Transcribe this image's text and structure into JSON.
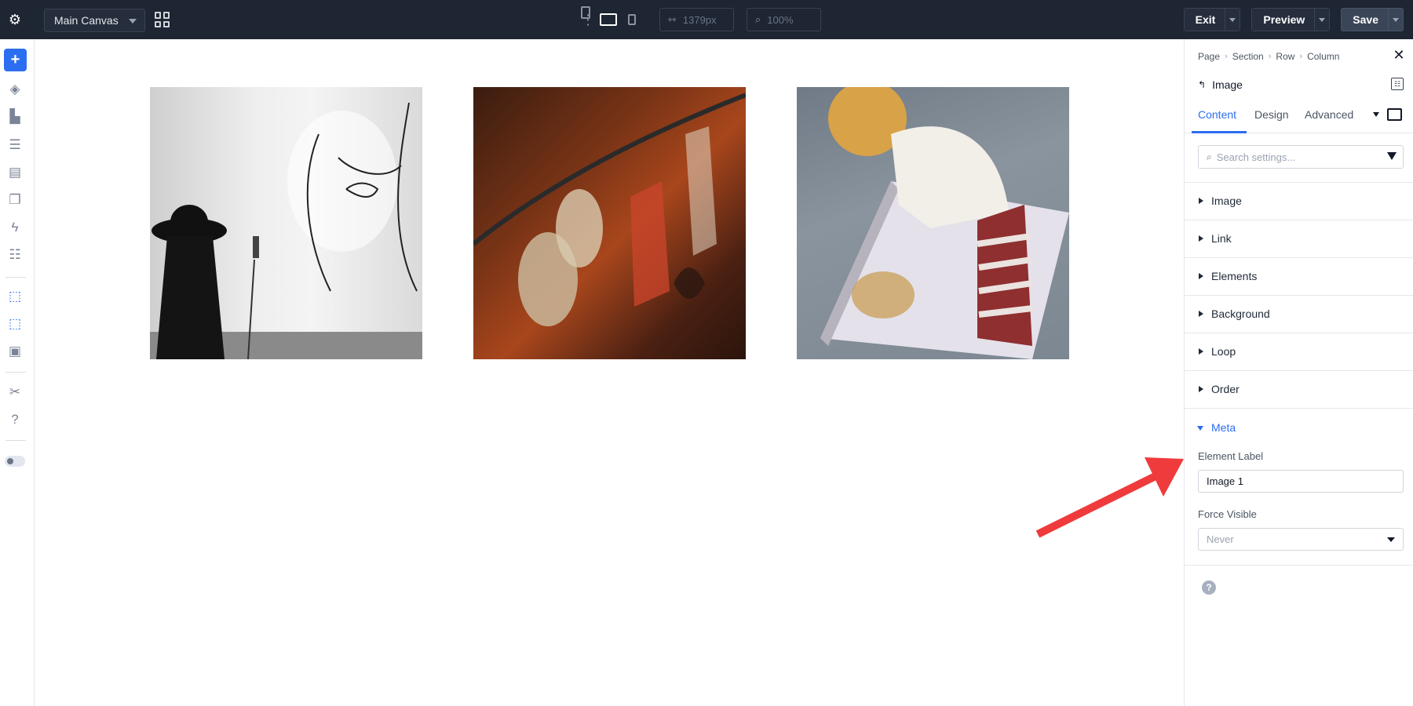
{
  "topbar": {
    "canvas_select": "Main Canvas",
    "width_value": "1379px",
    "zoom_value": "100%",
    "exit_label": "Exit",
    "preview_label": "Preview",
    "save_label": "Save"
  },
  "panel": {
    "breadcrumbs": [
      "Page",
      "Section",
      "Row",
      "Column"
    ],
    "element_title": "Image",
    "tabs": [
      "Content",
      "Design",
      "Advanced"
    ],
    "active_tab": "Content",
    "search_placeholder": "Search settings...",
    "groups": [
      "Image",
      "Link",
      "Elements",
      "Background",
      "Loop",
      "Order"
    ],
    "meta": {
      "title": "Meta",
      "element_label_label": "Element Label",
      "element_label_value": "Image 1",
      "force_visible_label": "Force Visible",
      "force_visible_value": "Never"
    },
    "help_icon": "?"
  },
  "canvas": {
    "images": [
      "gallery-image-1",
      "gallery-image-2",
      "gallery-image-3"
    ]
  },
  "colors": {
    "topbar_bg": "#1e2533",
    "accent": "#2b6ef2",
    "annotation_arrow": "#ef3b3b"
  }
}
